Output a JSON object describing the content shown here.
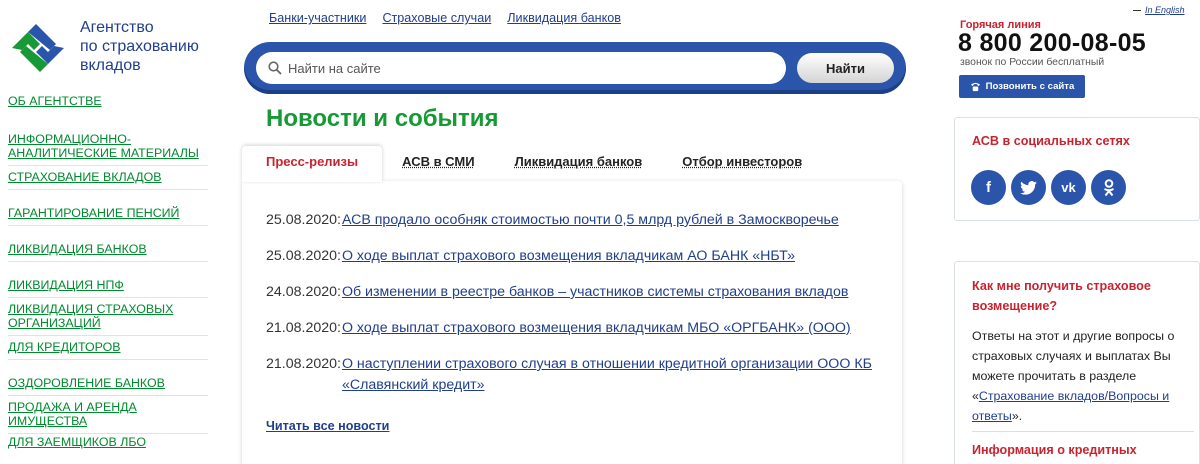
{
  "logo": {
    "lines": [
      "Агентство",
      "по страхованию",
      "вкладов"
    ]
  },
  "leftnav": [
    "ОБ АГЕНТСТВЕ",
    "ИНФОРМАЦИОННО-АНАЛИТИЧЕСКИЕ МАТЕРИАЛЫ",
    "СТРАХОВАНИЕ ВКЛАДОВ",
    "ГАРАНТИРОВАНИЕ ПЕНСИЙ",
    "ЛИКВИДАЦИЯ БАНКОВ",
    "ЛИКВИДАЦИЯ НПФ",
    "ЛИКВИДАЦИЯ СТРАХОВЫХ ОРГАНИЗАЦИЙ",
    "ДЛЯ КРЕДИТОРОВ",
    "ОЗДОРОВЛЕНИЕ БАНКОВ",
    "ПРОДАЖА И АРЕНДА ИМУЩЕСТВА",
    "ДЛЯ ЗАЕМЩИКОВ ЛБО"
  ],
  "toplinks": [
    "Банки-участники",
    "Страховые случаи",
    "Ликвидация банков"
  ],
  "search": {
    "placeholder": "Найти на сайте",
    "button": "Найти"
  },
  "page_title": "Новости и события",
  "tabs": [
    "Пресс-релизы",
    "АСВ в СМИ",
    "Ликвидация банков",
    "Отбор инвесторов"
  ],
  "news": [
    {
      "date": "25.08.2020:",
      "title": "АСВ продало особняк стоимостью почти 0,5 млрд рублей в Замоскворечье"
    },
    {
      "date": "25.08.2020:",
      "title": "О ходе выплат страхового возмещения вкладчикам АО БАНК «НБТ»"
    },
    {
      "date": "24.08.2020:",
      "title": "Об изменении в реестре банков – участников системы страхования вкладов"
    },
    {
      "date": "21.08.2020:",
      "title": "О ходе выплат страхового возмещения вкладчикам МБО «ОРГБАНК» (ООО)"
    },
    {
      "date": "21.08.2020:",
      "title": "О наступлении страхового случая в отношении кредитной организации ООО КБ «Славянский кредит»"
    }
  ],
  "read_all": "Читать все новости",
  "header_right": {
    "lang_link": "In English",
    "hotline_label": "Горячая линия",
    "phone": "8 800 200-08-05",
    "phone_note": "звонок по России бесплатный",
    "call_button": "Позвонить с сайта"
  },
  "social": {
    "title": "АСВ в социальных сетях",
    "icons": [
      "f",
      "t",
      "vk",
      "ok"
    ]
  },
  "faq": {
    "title": "Как мне получить страховое возмещение?",
    "text_before": "Ответы на этот и другие вопросы о страховых случаях и выплатах Вы можете прочитать в разделе «",
    "link": "Страхование вкладов/Вопросы и ответы",
    "text_after": "»."
  },
  "info_title": "Информация о кредитных",
  "colors": {
    "brand_blue": "#2a55aa",
    "link_blue": "#1f3f8c",
    "nav_green": "#008a2e",
    "title_green": "#179a36",
    "accent_red": "#c8242f"
  }
}
